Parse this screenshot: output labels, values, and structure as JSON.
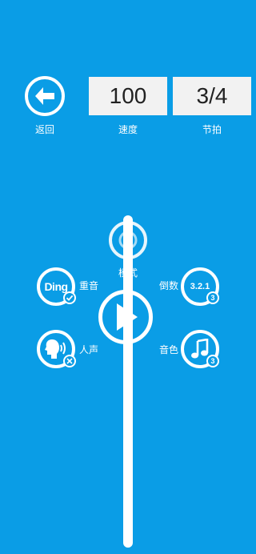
{
  "header": {
    "back_label": "返回",
    "tempo_value": "100",
    "tempo_label": "速度",
    "beat_value": "3/4",
    "beat_label": "节拍"
  },
  "controls": {
    "mode_label": "模式",
    "accent_label": "重音",
    "accent_icon_text": "Ding",
    "countdown_label": "倒数",
    "countdown_icon_text": "3.2.1",
    "countdown_badge": "3",
    "voice_label": "人声",
    "timbre_label": "音色",
    "timbre_badge": "3"
  },
  "colors": {
    "background": "#0a9de6",
    "field_bg": "#f2f2f2",
    "foreground": "#ffffff"
  }
}
